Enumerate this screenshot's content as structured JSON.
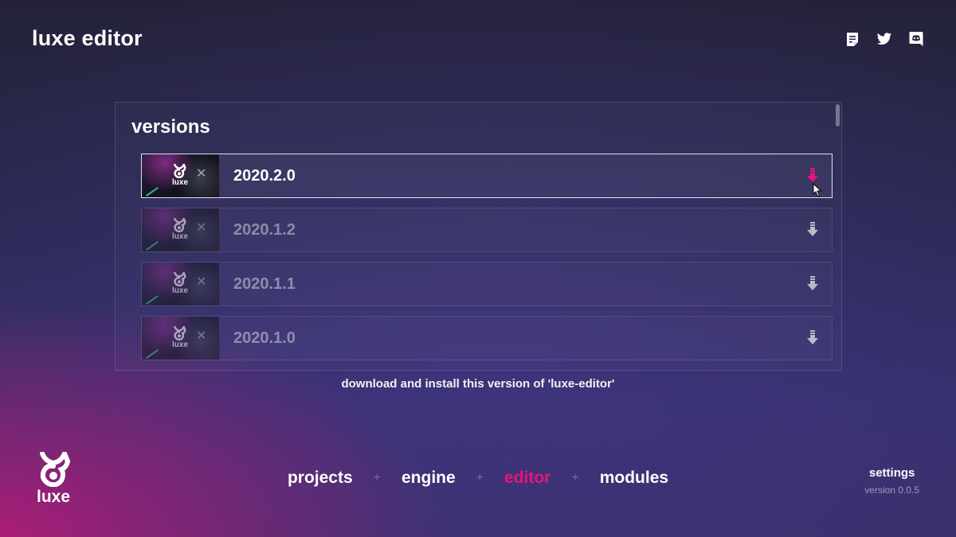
{
  "app": {
    "title": "luxe editor"
  },
  "top_icons": [
    "notes-icon",
    "twitter-icon",
    "discord-icon"
  ],
  "versions_panel": {
    "title": "versions",
    "items": [
      {
        "label": "2020.2.0",
        "thumb_word": "luxe",
        "state": "hovered",
        "action_icon": "download-icon"
      },
      {
        "label": "2020.1.2",
        "thumb_word": "luxe",
        "state": "normal",
        "action_icon": "download-icon"
      },
      {
        "label": "2020.1.1",
        "thumb_word": "luxe",
        "state": "normal",
        "action_icon": "download-icon"
      },
      {
        "label": "2020.1.0",
        "thumb_word": "luxe",
        "state": "normal",
        "action_icon": "download-icon"
      }
    ]
  },
  "hint": "download and install this version of 'luxe-editor'",
  "brand": {
    "word": "luxe"
  },
  "nav": {
    "items": [
      {
        "label": "projects",
        "current": false
      },
      {
        "label": "engine",
        "current": false
      },
      {
        "label": "editor",
        "current": true
      },
      {
        "label": "modules",
        "current": false
      }
    ],
    "separator": "+"
  },
  "settings": {
    "label": "settings",
    "version": "version 0.0.5"
  },
  "colors": {
    "accent": "#e8147a",
    "inactive_icon": "#b9bcc8",
    "text": "#ffffff"
  }
}
